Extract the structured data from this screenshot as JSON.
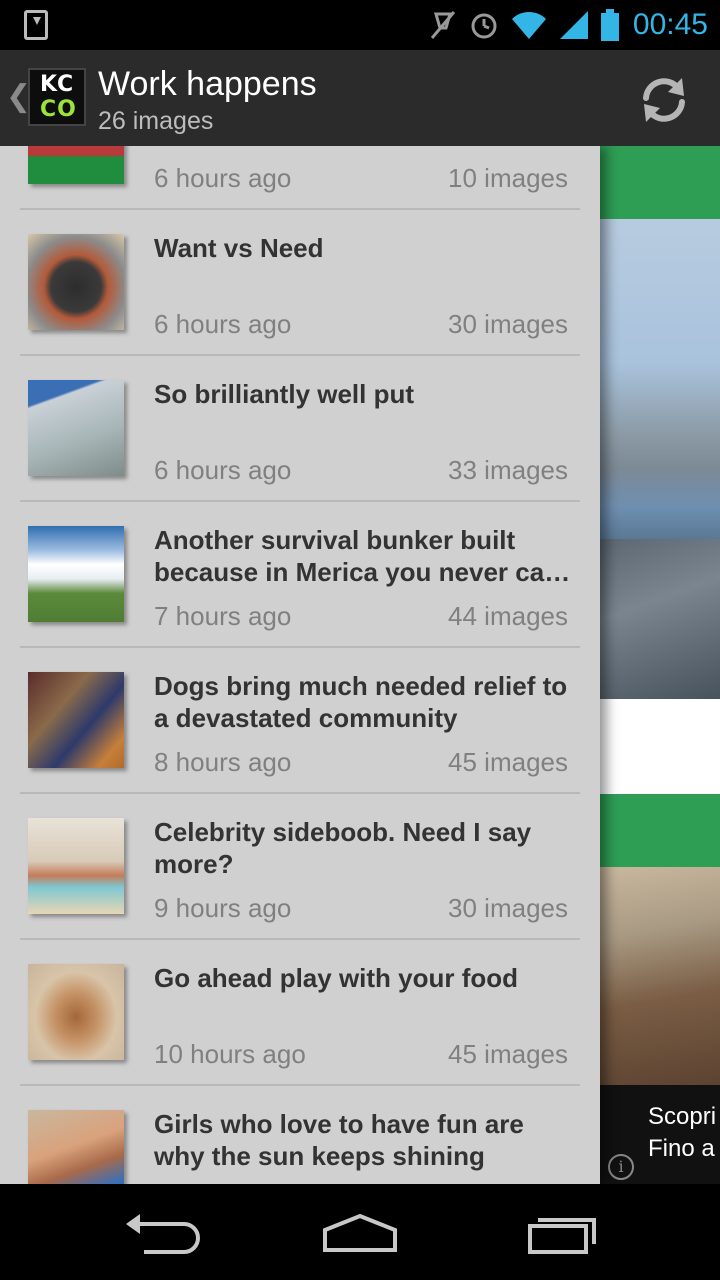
{
  "status_bar": {
    "time": "00:45",
    "icons": [
      "download-notification-icon",
      "mute-icon",
      "alarm-icon",
      "wifi-icon",
      "signal-icon",
      "battery-icon"
    ],
    "time_color": "#33b5e5"
  },
  "action_bar": {
    "back_glyph": "❮",
    "logo_line1": "KC",
    "logo_line2": "CO",
    "title": "Work happens",
    "subtitle": "26 images",
    "refresh_icon": "refresh-icon"
  },
  "drawer": {
    "items": [
      {
        "title": "",
        "time": "6 hours ago",
        "count": "10 images"
      },
      {
        "title": "Want vs Need",
        "time": "6 hours ago",
        "count": "30 images"
      },
      {
        "title": "So brilliantly well put",
        "time": "6 hours ago",
        "count": "33 images"
      },
      {
        "title_line1": "Another survival bunker built",
        "title_line2": "because in Merica you never ca…",
        "time": "7 hours ago",
        "count": "44 images"
      },
      {
        "title": "Dogs bring much needed relief to a devastated community",
        "time": "8 hours ago",
        "count": "45 images"
      },
      {
        "title": "Celebrity sideboob. Need I say more?",
        "time": "9 hours ago",
        "count": "30 images"
      },
      {
        "title": "Go ahead play with your food",
        "time": "10 hours ago",
        "count": "45 images"
      },
      {
        "title": "Girls who love to have fun are why the sun keeps shining",
        "time": "",
        "count": ""
      }
    ]
  },
  "ad": {
    "line1": "Scopri",
    "line2": "Fino a",
    "info_glyph": "i"
  },
  "nav_bar": {
    "buttons": [
      "back-icon",
      "home-icon",
      "recent-apps-icon"
    ]
  },
  "colors": {
    "accent_green": "#2e9e55",
    "drawer_bg": "#d0d0d0",
    "action_bar_bg": "#2b2b2b",
    "logo_green": "#9be33a"
  }
}
